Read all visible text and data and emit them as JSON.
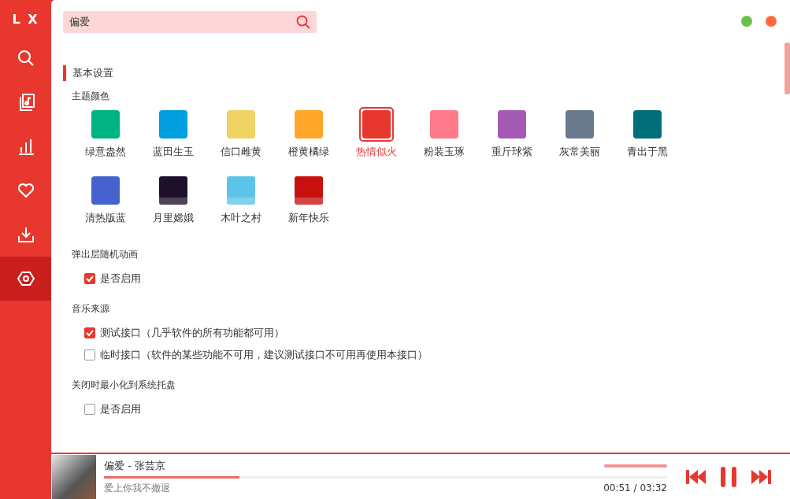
{
  "app_logo": "L X",
  "sidebar": {
    "items": [
      {
        "kind": "search",
        "selected": false
      },
      {
        "kind": "music-list",
        "selected": false
      },
      {
        "kind": "chart",
        "selected": false
      },
      {
        "kind": "heart",
        "selected": false
      },
      {
        "kind": "download",
        "selected": false
      },
      {
        "kind": "settings",
        "selected": true
      }
    ]
  },
  "search": {
    "value": "偏爱"
  },
  "settings": {
    "section_title": "基本设置",
    "groups": [
      {
        "title": "主题颜色",
        "kind": "themes",
        "themes": [
          {
            "name": "绿意盎然",
            "kind": "swatch",
            "color": "#00b383",
            "selected": false
          },
          {
            "name": "蓝田生玉",
            "kind": "swatch",
            "color": "#009fe0",
            "selected": false
          },
          {
            "name": "信口雌黄",
            "kind": "swatch",
            "color": "#f0d265",
            "selected": false
          },
          {
            "name": "橙黄橘绿",
            "kind": "swatch",
            "color": "#ffa62b",
            "selected": false
          },
          {
            "name": "热情似火",
            "kind": "swatch",
            "color": "#e8372f",
            "selected": true
          },
          {
            "name": "粉装玉琢",
            "kind": "swatch",
            "color": "#ff7b8b",
            "selected": false
          },
          {
            "name": "重斤球紫",
            "kind": "swatch",
            "color": "#a55ab3",
            "selected": false
          },
          {
            "name": "灰常美丽",
            "kind": "swatch",
            "color": "#687a8b",
            "selected": false
          },
          {
            "name": "青出于黑",
            "kind": "swatch",
            "color": "#006f79",
            "selected": false
          },
          {
            "name": "清热版蓝",
            "kind": "swatch",
            "color": "#4662cf",
            "selected": false
          },
          {
            "name": "月里嫦娥",
            "kind": "image",
            "color": "#1e0f2b",
            "selected": false
          },
          {
            "name": "木叶之村",
            "kind": "image",
            "color": "#5cc4e8",
            "selected": false
          },
          {
            "name": "新年快乐",
            "kind": "image",
            "color": "#c8100e",
            "selected": false
          }
        ]
      },
      {
        "title": "弹出层随机动画",
        "kind": "checkboxes",
        "options": [
          {
            "label": "是否启用",
            "checked": true
          }
        ]
      },
      {
        "title": "音乐来源",
        "kind": "checkboxes",
        "options": [
          {
            "label": "测试接口（几乎软件的所有功能都可用）",
            "checked": true
          },
          {
            "label": "临时接口（软件的某些功能不可用，建议测试接口不可用再使用本接口）",
            "checked": false
          }
        ]
      },
      {
        "title": "关闭时最小化到系统托盘",
        "kind": "checkboxes",
        "options": [
          {
            "label": "是否启用",
            "checked": false
          }
        ]
      }
    ]
  },
  "player": {
    "title": "偏爱 - 张芸京",
    "lyric": "爱上你我不撤退",
    "time": "00:51 / 03:32",
    "progress": {
      "level": 0.24
    },
    "volume": {
      "level": 1.0
    },
    "controls": [
      {
        "kind": "previous"
      },
      {
        "kind": "pause"
      },
      {
        "kind": "next"
      }
    ]
  }
}
